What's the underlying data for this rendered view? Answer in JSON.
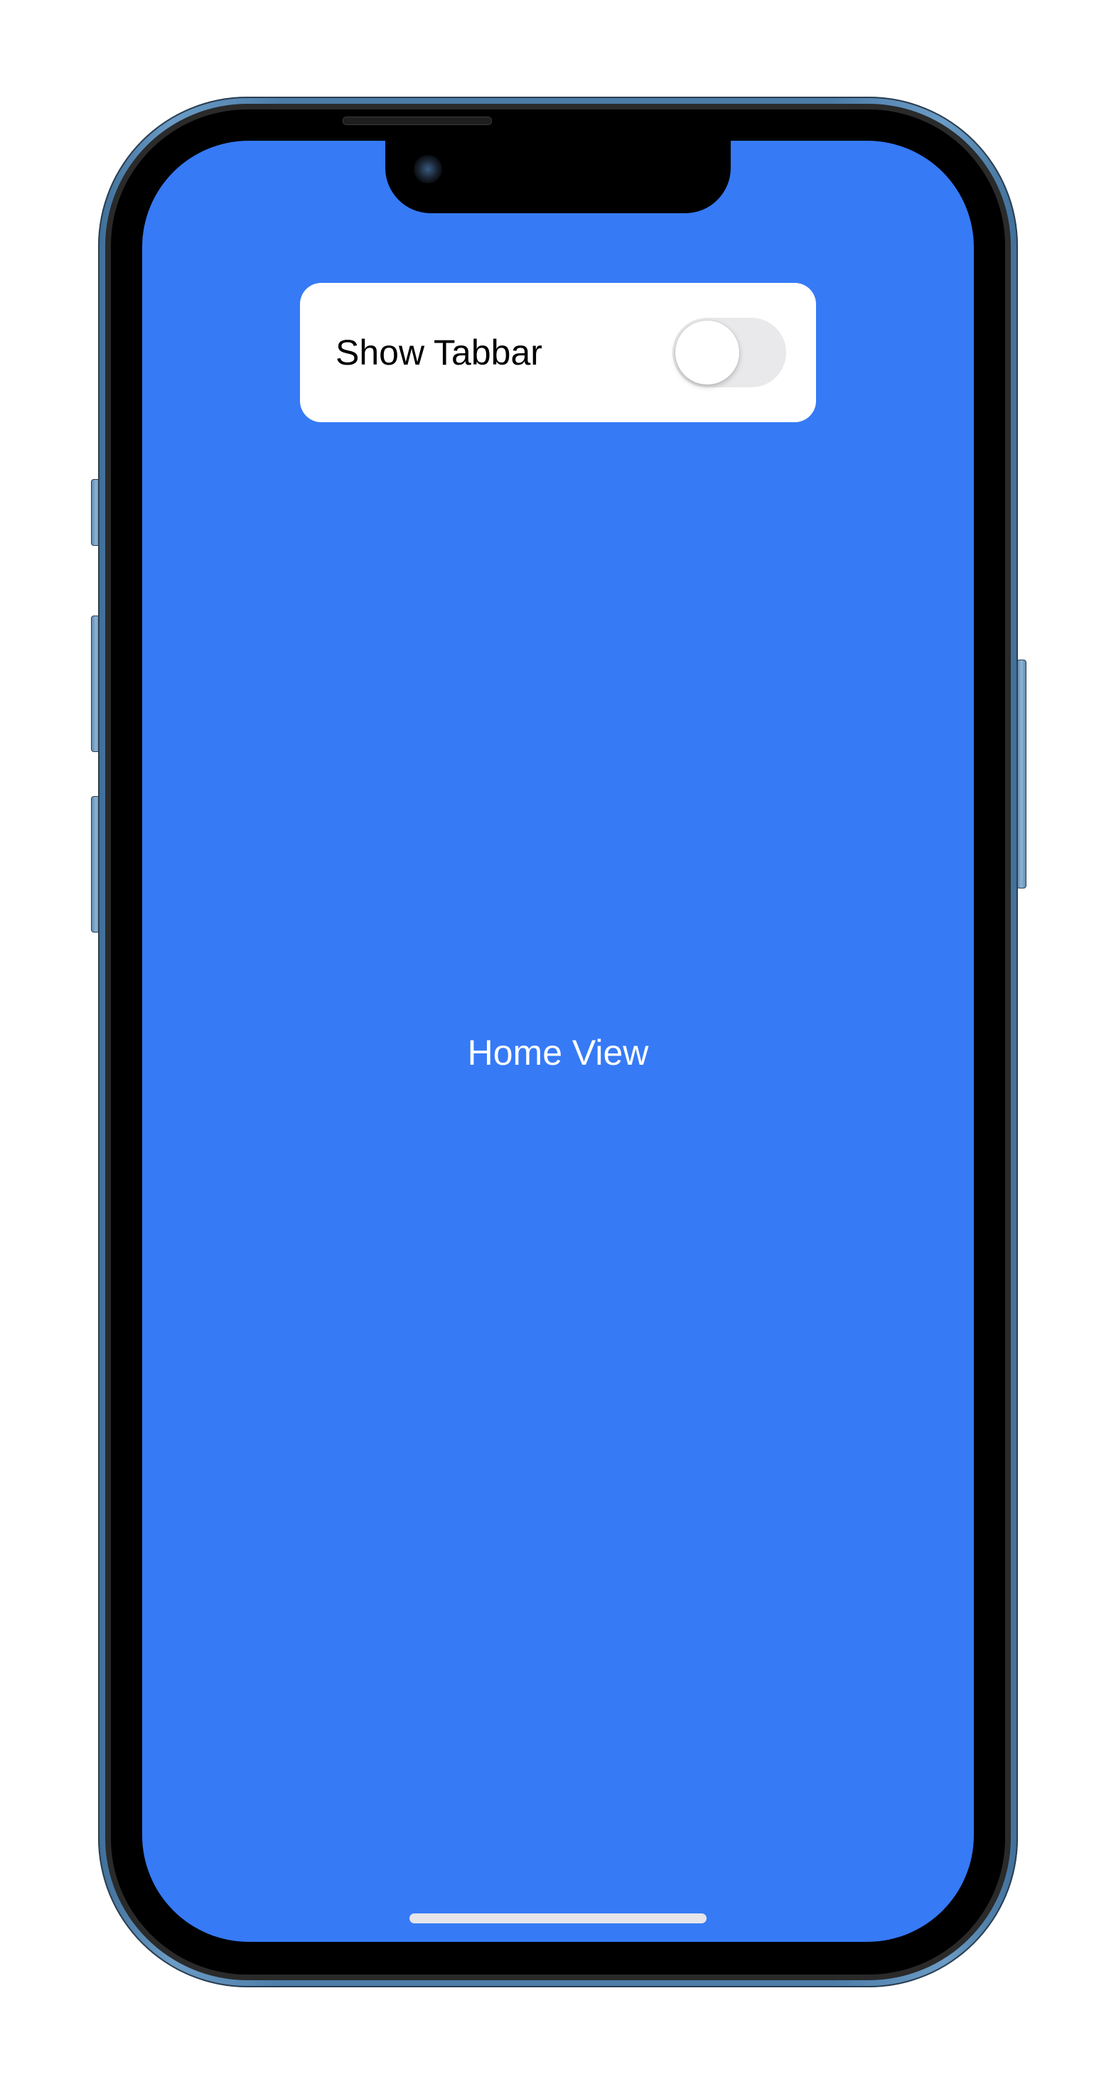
{
  "app": {
    "toggle_card": {
      "label": "Show Tabbar",
      "toggle_state": "off"
    },
    "main": {
      "title": "Home View"
    }
  },
  "colors": {
    "screen_background": "#367af6",
    "card_background": "#ffffff",
    "toggle_track_off": "#e9e9eb",
    "frame_color": "#4c7ca8"
  }
}
